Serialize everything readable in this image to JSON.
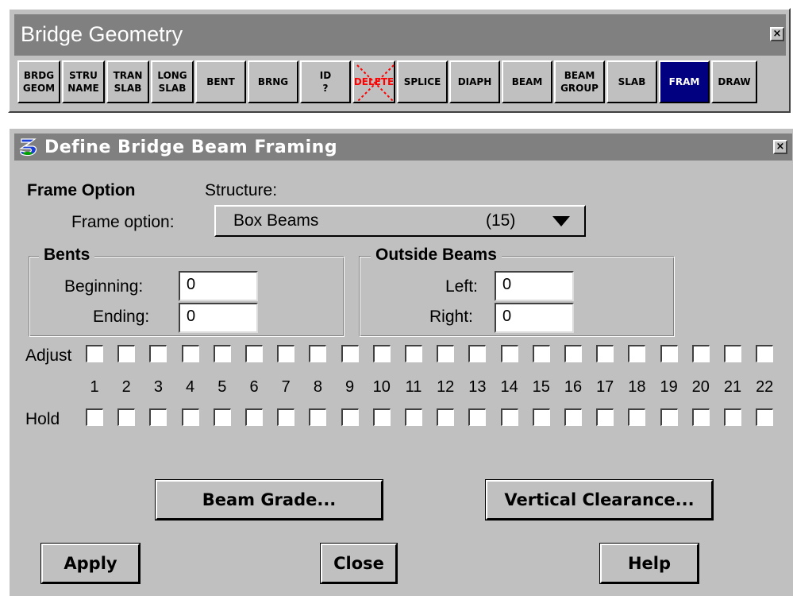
{
  "palette": {
    "title": "Bridge Geometry",
    "close_glyph": "×",
    "tools": [
      {
        "label": "BRDG\nGEOM",
        "name": "tool-brdg-geom"
      },
      {
        "label": "STRU\nNAME",
        "name": "tool-stru-name"
      },
      {
        "label": "TRAN\nSLAB",
        "name": "tool-tran-slab"
      },
      {
        "label": "LONG\nSLAB",
        "name": "tool-long-slab"
      },
      {
        "label": "BENT",
        "name": "tool-bent"
      },
      {
        "label": "BRNG",
        "name": "tool-brng"
      },
      {
        "label": "ID\n?",
        "name": "tool-id"
      },
      {
        "label": "DELETE",
        "name": "tool-delete"
      },
      {
        "label": "SPLICE",
        "name": "tool-splice"
      },
      {
        "label": "DIAPH",
        "name": "tool-diaph"
      },
      {
        "label": "BEAM",
        "name": "tool-beam"
      },
      {
        "label": "BEAM\nGROUP",
        "name": "tool-beam-group"
      },
      {
        "label": "SLAB",
        "name": "tool-slab"
      },
      {
        "label": "FRAM",
        "name": "tool-fram"
      },
      {
        "label": "DRAW",
        "name": "tool-draw"
      }
    ],
    "active_tool": "FRAM"
  },
  "dialog": {
    "title": "Define Bridge Beam Framing",
    "close_glyph": "×",
    "frame_option_heading": "Frame Option",
    "structure_label": "Structure:",
    "frame_option_label": "Frame option:",
    "frame_option_value": "Box Beams",
    "frame_option_count": "(15)",
    "bents": {
      "legend": "Bents",
      "beginning_label": "Beginning:",
      "beginning_value": "0",
      "ending_label": "Ending:",
      "ending_value": "0"
    },
    "outside_beams": {
      "legend": "Outside Beams",
      "left_label": "Left:",
      "left_value": "0",
      "right_label": "Right:",
      "right_value": "0"
    },
    "adjust_label": "Adjust",
    "hold_label": "Hold",
    "beam_numbers": [
      "1",
      "2",
      "3",
      "4",
      "5",
      "6",
      "7",
      "8",
      "9",
      "10",
      "11",
      "12",
      "13",
      "14",
      "15",
      "16",
      "17",
      "18",
      "19",
      "20",
      "21",
      "22"
    ],
    "buttons": {
      "beam_grade": "Beam Grade...",
      "vertical_clearance": "Vertical Clearance...",
      "apply": "Apply",
      "close": "Close",
      "help": "Help"
    }
  },
  "colors": {
    "face": "#c0c0c0",
    "titlebar": "#808080",
    "active_tool": "#000080",
    "delete_red": "#ff0000",
    "app_icon_blue": "#1a3fd6"
  }
}
